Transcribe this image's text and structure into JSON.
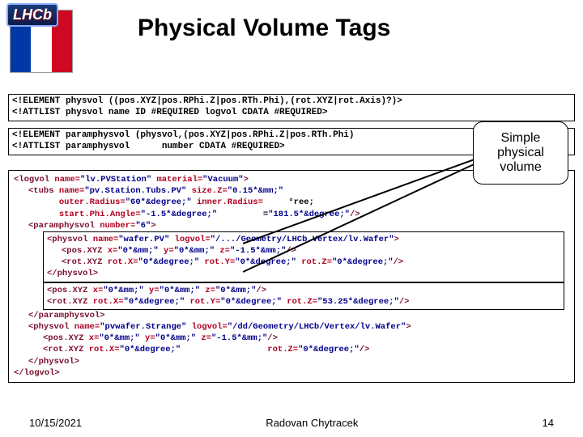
{
  "logo": {
    "brand": "LHCb"
  },
  "title": "Physical Volume Tags",
  "callout": {
    "l1": "Simple",
    "l2": "physical",
    "l3": "volume"
  },
  "dtd1_l1": "<!ELEMENT physvol ((pos.XYZ|pos.RPhi.Z|pos.RTh.Phi),(rot.XYZ|rot.Axis)?)>",
  "dtd1_l2": "<!ATTLIST physvol name ID #REQUIRED logvol CDATA #REQUIRED>",
  "dtd2_l1": "<!ELEMENT paramphysvol (physvol,(pos.XYZ|pos.RPhi.Z|pos.RTh.Phi)",
  "dtd2_l2": "<!ATTLIST paramphysvol      number CDATA #REQUIRED>",
  "code": {
    "logvol_open": {
      "p": "<logvol ",
      "name_a": "name=",
      "name_v": "\"lv.PVStation\"",
      "mat_a": " material=",
      "mat_v": "\"Vacuum\"",
      "close": ">"
    },
    "tubs": {
      "p": "<tubs ",
      "name_a": "name=",
      "name_v": "\"pv.Station.Tubs.PV\"",
      "sz_a": " size.Z=",
      "sz_v": "\"0.15*&mm;\"",
      "or_a": "outer.Radius=",
      "or_v": "\"60*&degree;\"",
      "ir_a": " inner.Radius=",
      "sp_a": "start.Phi.Angle=",
      "sp_v": "\"-1.5*&degree;\"",
      "dp_v": "\"181.5*&degree;\"",
      "end": "/>"
    },
    "paramphysvol_open": {
      "p": "<paramphysvol ",
      "a": "number=",
      "v": "\"6\"",
      "close": ">"
    },
    "physvol1_open": {
      "p": "<physvol ",
      "na": "name=",
      "nv": "\"wafer.PV\"",
      "la": " logvol=",
      "lv": "\"/.../Geometry/LHCb.Vertex/lv.Wafer\"",
      "close": ">"
    },
    "posxyz1": {
      "p": "<pos.XYZ ",
      "xa": "x=",
      "xv": "\"0*&mm;\"",
      "ya": " y=",
      "yv": "\"0*&mm;\"",
      "za": " z=",
      "zv": "\"-1.5*&mm;\"",
      "e": "/>"
    },
    "rotxyz1": {
      "p": "<rot.XYZ ",
      "xa": "rot.X=",
      "xv": "\"0*&degree;\"",
      "ya": " rot.Y=",
      "yv": "\"0*&degree;\"",
      "za": " rot.Z=",
      "zv": "\"0*&degree;\"",
      "e": "/>"
    },
    "physvol_close": "</physvol>",
    "posxyz2": {
      "p": "<pos.XYZ ",
      "xa": "x=",
      "xv": "\"0*&mm;\"",
      "ya": " y=",
      "yv": "\"0*&mm;\"",
      "za": " z=",
      "zv": "\"0*&mm;\"",
      "e": "/>"
    },
    "rotxyz2": {
      "p": "<rot.XYZ ",
      "xa": "rot.X=",
      "xv": "\"0*&degree;\"",
      "ya": " rot.Y=",
      "yv": "\"0*&degree;\"",
      "za": " rot.Z=",
      "zv": "\"53.25*&degree;\"",
      "e": "/>"
    },
    "paramphysvol_close": "</paramphysvol>",
    "physvol2_open": {
      "p": "<physvol ",
      "na": "name=",
      "nv": "\"pvwafer.Strange\"",
      "la": " logvol=",
      "lv": "\"/dd/Geometry/LHCb/Vertex/lv.Wafer\"",
      "close": ">"
    },
    "posxyz3": {
      "p": "<pos.XYZ ",
      "xa": "x=",
      "xv": "\"0*&mm;\"",
      "ya": " y=",
      "yv": "\"0*&mm;\"",
      "za": " z=",
      "zv": "\"-1.5*&mm;\"",
      "e": "/>"
    },
    "rotxyz3": {
      "p": "<rot.XYZ ",
      "xa": "rot.X=",
      "xv": "\"0*&degree;\"",
      "za": " rot.Z=",
      "zv": "\"0*&degree;\"",
      "e": "/>"
    },
    "logvol_close": "</logvol>"
  },
  "footer": {
    "date": "10/15/2021",
    "author": "Radovan Chytracek",
    "page": "14"
  }
}
